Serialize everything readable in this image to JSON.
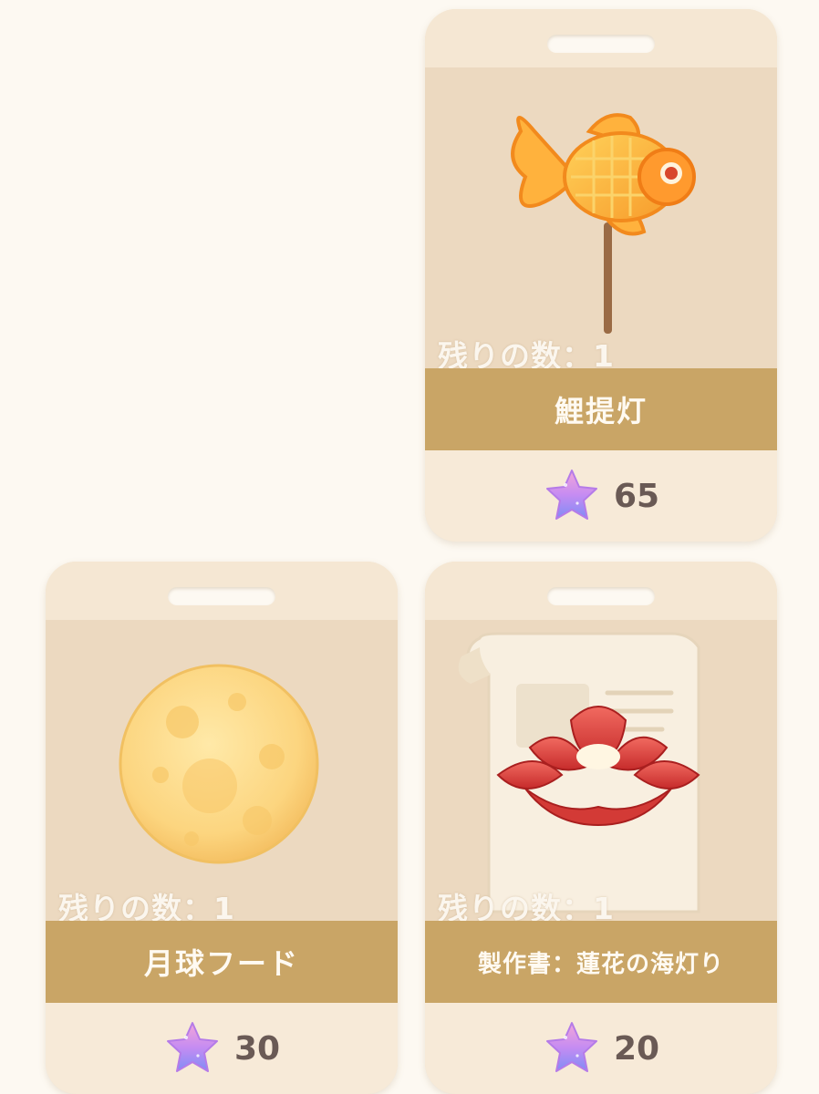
{
  "shop": {
    "items": [
      {
        "name": "鯉提灯",
        "stock_label": "残りの数：1",
        "price": "65",
        "icon": "goldfish-lantern-icon",
        "currency_icon": "star-icon"
      },
      {
        "name": "月球フード",
        "stock_label": "残りの数：1",
        "price": "30",
        "icon": "moon-food-icon",
        "currency_icon": "star-icon"
      },
      {
        "name": "製作書：蓮花の海灯り",
        "stock_label": "残りの数：1",
        "price": "20",
        "icon": "lotus-lamp-recipe-icon",
        "currency_icon": "star-icon"
      }
    ]
  },
  "colors": {
    "background": "#fdf9f2",
    "card": "#f1e1ca",
    "name_band": "#c9a566",
    "price_text": "#6a5a55"
  }
}
